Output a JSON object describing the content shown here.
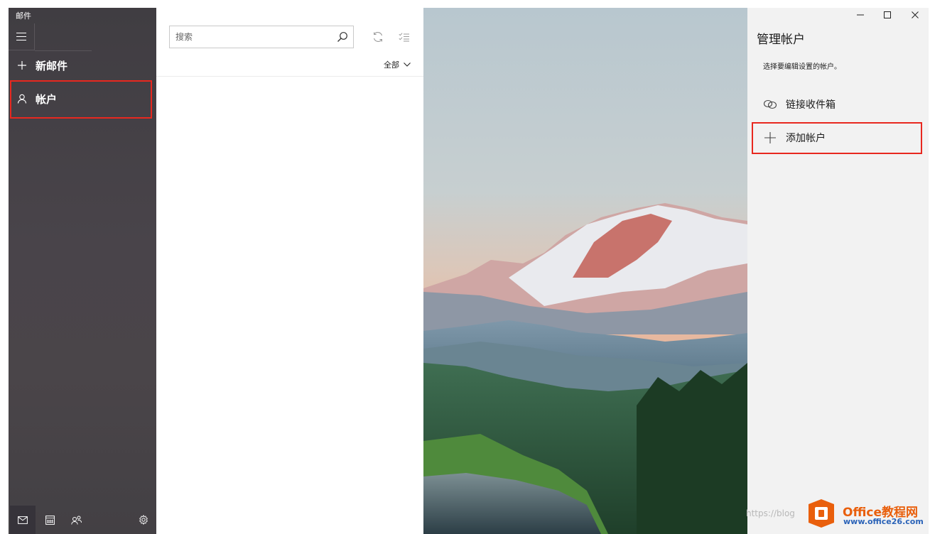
{
  "app": {
    "title": "邮件"
  },
  "sidebar": {
    "new_mail_label": "新邮件",
    "accounts_label": "帐户",
    "icons": [
      "hamburger-icon",
      "plus-icon",
      "person-icon",
      "mail-icon",
      "calendar-icon",
      "people-icon",
      "gear-icon"
    ]
  },
  "list": {
    "search_placeholder": "搜索",
    "filter_label": "全部"
  },
  "manage": {
    "title": "管理帐户",
    "subtitle": "选择要编辑设置的帐户。",
    "link_inboxes_label": "链接收件箱",
    "add_account_label": "添加帐户"
  },
  "colors": {
    "sidebar_bg": "#47434a",
    "highlight": "#e8281f",
    "pane_bg": "#f2f2f2"
  },
  "watermark": {
    "blog_text": "https://blog",
    "brand": "Office教程网",
    "url": "www.office26.com"
  }
}
